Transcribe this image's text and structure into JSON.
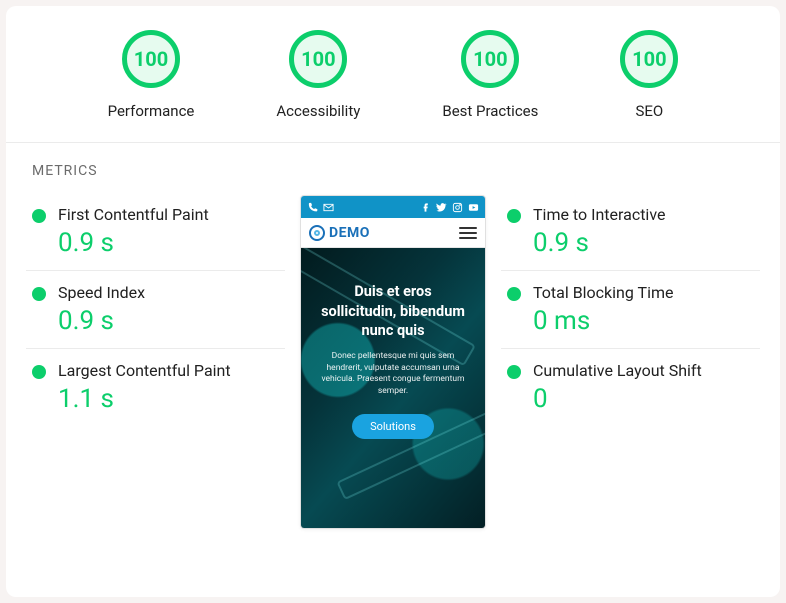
{
  "scores": [
    {
      "value": "100",
      "label": "Performance"
    },
    {
      "value": "100",
      "label": "Accessibility"
    },
    {
      "value": "100",
      "label": "Best Practices"
    },
    {
      "value": "100",
      "label": "SEO"
    }
  ],
  "section_title": "METRICS",
  "metrics_left": [
    {
      "label": "First Contentful Paint",
      "value": "0.9 s"
    },
    {
      "label": "Speed Index",
      "value": "0.9 s"
    },
    {
      "label": "Largest Contentful Paint",
      "value": "1.1 s"
    }
  ],
  "metrics_right": [
    {
      "label": "Time to Interactive",
      "value": "0.9 s"
    },
    {
      "label": "Total Blocking Time",
      "value": "0 ms"
    },
    {
      "label": "Cumulative Layout Shift",
      "value": "0"
    }
  ],
  "preview": {
    "logo_text": "DEMO",
    "hero_title": "Duis et eros sollicitudin, bibendum nunc quis",
    "hero_copy": "Donec pellentesque mi quis sem hendrerit, vulputate accumsan urna vehicula. Praesent congue fermentum semper.",
    "cta_label": "Solutions"
  }
}
